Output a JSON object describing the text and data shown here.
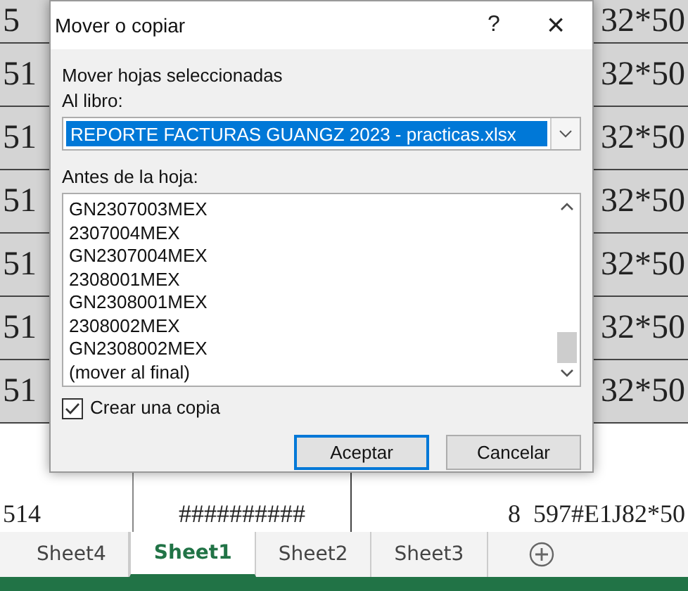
{
  "sheet": {
    "rows": [
      {
        "col_a": "5",
        "col_c": "32*50"
      },
      {
        "col_a": "51",
        "col_c": "32*50"
      },
      {
        "col_a": "51",
        "col_c": "32*50"
      },
      {
        "col_a": "51",
        "col_c": "32*50"
      },
      {
        "col_a": "51",
        "col_c": "32*50"
      },
      {
        "col_a": "51",
        "col_c": "32*50"
      },
      {
        "col_a": "51",
        "col_c": "32*50"
      },
      {
        "col_a": "514",
        "col_b": "##########",
        "col_c": "8  597#E1J82*50"
      }
    ]
  },
  "dialog": {
    "title": "Mover o copiar",
    "help": "?",
    "close": "×",
    "heading": "Mover hojas seleccionadas",
    "book_label": "Al libro:",
    "book": {
      "value": "REPORTE FACTURAS GUANGZ 2023 - practicas.xlsx",
      "selected": true
    },
    "before_label": "Antes de la hoja:",
    "sheets": [
      {
        "label": "GN2307003MEX",
        "selected": false
      },
      {
        "label": "2307004MEX",
        "selected": false
      },
      {
        "label": "GN2307004MEX",
        "selected": false
      },
      {
        "label": "2308001MEX",
        "selected": false
      },
      {
        "label": "GN2308001MEX",
        "selected": false
      },
      {
        "label": "2308002MEX",
        "selected": false
      },
      {
        "label": "GN2308002MEX",
        "selected": false
      },
      {
        "label": "(mover al final)",
        "selected": false
      }
    ],
    "copy": {
      "label": "Crear una copia",
      "checked": true
    },
    "buttons": [
      {
        "label": "Aceptar",
        "default": true
      },
      {
        "label": "Cancelar",
        "default": false
      }
    ]
  },
  "tabs": [
    {
      "label": "Sheet4",
      "selected": false
    },
    {
      "label": "Sheet1",
      "selected": true
    },
    {
      "label": "Sheet2",
      "selected": false
    },
    {
      "label": "Sheet3",
      "selected": false
    }
  ]
}
